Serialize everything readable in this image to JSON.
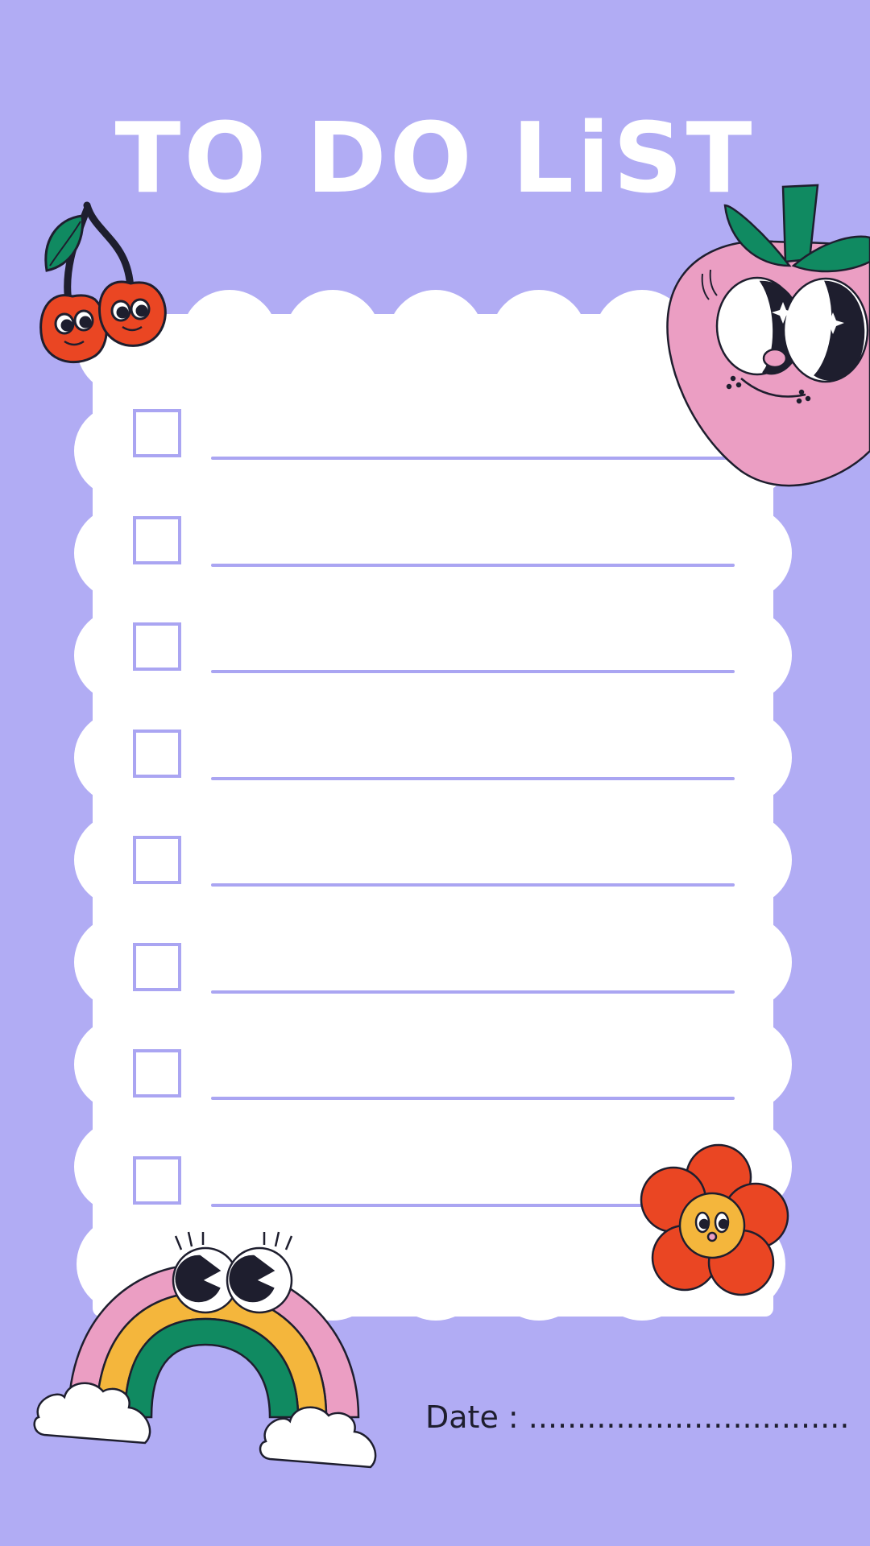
{
  "title": "TO DO LiST",
  "date_label": "Date : .................................",
  "colors": {
    "background": "#b1acf4",
    "paper": "#ffffff",
    "line": "#aaa5f2",
    "title": "#ffffff",
    "ink": "#1e1e2e"
  },
  "tasks": [
    "",
    "",
    "",
    "",
    "",
    "",
    "",
    ""
  ],
  "decorations": [
    "cherries-icon",
    "strawberry-icon",
    "flower-icon",
    "rainbow-icon"
  ]
}
